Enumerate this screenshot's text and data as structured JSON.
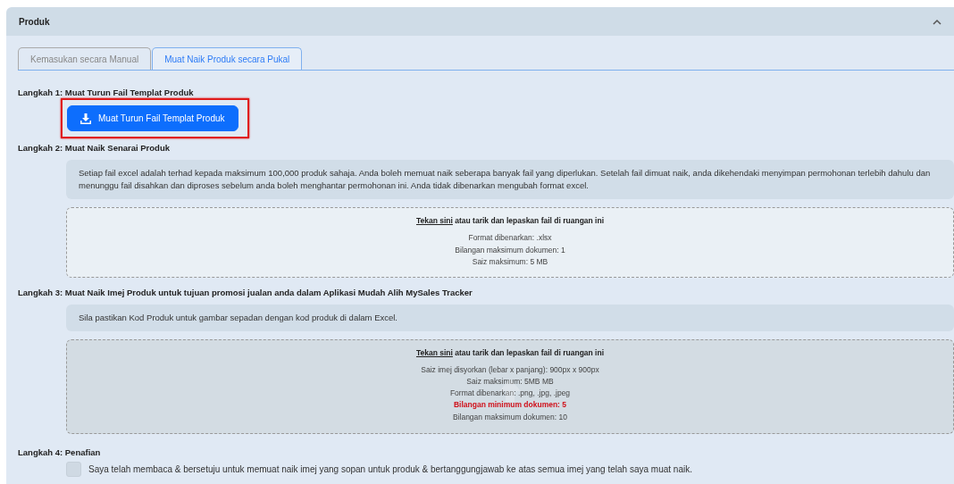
{
  "panel": {
    "title": "Produk",
    "expanded": true
  },
  "tabs": [
    {
      "label": "Kemasukan secara Manual",
      "selected": false
    },
    {
      "label": "Muat Naik Produk secara Pukal",
      "selected": true
    }
  ],
  "steps": [
    {
      "title": "Langkah 1: Muat Turun Fail Templat Produk",
      "kind": "button",
      "button": {
        "label": "Muat Turun Fail Templat Produk",
        "highlighted": true
      }
    },
    {
      "title": "Langkah 2: Muat Naik Senarai Produk",
      "kind": "upload",
      "info": "Setiap fail excel adalah terhad kepada maksimum 100,000 produk sahaja. Anda boleh memuat naik seberapa banyak fail yang diperlukan. Setelah fail dimuat naik, anda dikehendaki menyimpan permohonan terlebih dahulu dan menunggu fail disahkan dan diproses sebelum anda boleh menghantar permohonan ini. Anda tidak dibenarkan mengubah format excel.",
      "dropzone": {
        "link": "Tekan sini",
        "prompt": "atau tarik dan lepaskan fail di ruangan ini",
        "disabled": false,
        "lines": [
          {
            "text": "Format dibenarkan: .xlsx",
            "warning": false
          },
          {
            "text": "Bilangan maksimum dokumen: 1",
            "warning": false
          },
          {
            "text": "Saiz maksimum: 5 MB",
            "warning": false
          }
        ]
      }
    },
    {
      "title": "Langkah 3: Muat Naik Imej Produk untuk tujuan promosi jualan anda dalam Aplikasi Mudah Alih MySales Tracker",
      "kind": "upload",
      "info": "Sila pastikan Kod Produk untuk gambar sepadan dengan kod produk di dalam Excel.",
      "dropzone": {
        "link": "Tekan sini",
        "prompt": "atau tarik dan lepaskan fail di ruangan ini",
        "disabled": true,
        "lines": [
          {
            "text": "Saiz imej disyorkan (lebar x panjang): 900px x 900px",
            "warning": false
          },
          {
            "text": "Saiz maksimum: 5MB MB",
            "warning": false
          },
          {
            "text": "Format dibenarkan: .png, .jpg, .jpeg",
            "warning": false
          },
          {
            "text": "Bilangan minimum dokumen: 5",
            "warning": true
          },
          {
            "text": "Bilangan maksimum dokumen: 10",
            "warning": false
          }
        ]
      }
    },
    {
      "title": "Langkah 4: Penafian",
      "kind": "checkbox",
      "checkbox": {
        "label": "Saya telah membaca & bersetuju untuk memuat naik imej yang sopan untuk produk & bertanggungjawab ke atas semua imej yang telah saya muat naik.",
        "checked": false
      }
    }
  ]
}
